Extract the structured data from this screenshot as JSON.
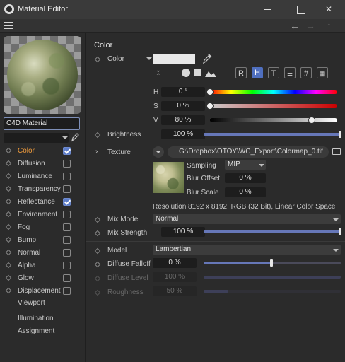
{
  "window": {
    "title": "Material Editor",
    "app_icon": "cinema4d-icon"
  },
  "toolbar": {
    "menu_icon": "hamburger-icon",
    "back_icon": "arrow-left-icon",
    "forward_icon": "arrow-right-icon",
    "up_icon": "arrow-up-icon"
  },
  "material": {
    "name": "C4D Material",
    "layer_value": ""
  },
  "channels": [
    {
      "label": "Color",
      "checked": true,
      "active": true
    },
    {
      "label": "Diffusion",
      "checked": false,
      "active": false
    },
    {
      "label": "Luminance",
      "checked": false,
      "active": false
    },
    {
      "label": "Transparency",
      "checked": false,
      "active": false
    },
    {
      "label": "Reflectance",
      "checked": true,
      "active": false
    },
    {
      "label": "Environment",
      "checked": false,
      "active": false
    },
    {
      "label": "Fog",
      "checked": false,
      "active": false
    },
    {
      "label": "Bump",
      "checked": false,
      "active": false
    },
    {
      "label": "Normal",
      "checked": false,
      "active": false
    },
    {
      "label": "Alpha",
      "checked": false,
      "active": false
    },
    {
      "label": "Glow",
      "checked": false,
      "active": false
    },
    {
      "label": "Displacement",
      "checked": false,
      "active": false
    }
  ],
  "extra_items": [
    "Viewport",
    "Illumination",
    "Assignment"
  ],
  "color_section": {
    "title": "Color",
    "color_label": "Color",
    "swatch_color": "#e8e8e8",
    "mode_letters": [
      "R",
      "H",
      "T",
      "#"
    ],
    "selected_mode": "H",
    "h_label": "H",
    "h_value": "0 °",
    "h_level": 0.0,
    "s_label": "S",
    "s_value": "0 %",
    "s_level": 0.0,
    "v_label": "V",
    "v_value": "80 %",
    "v_level": 0.8,
    "brightness_label": "Brightness",
    "brightness_value": "100 %",
    "brightness_level": 1.0,
    "texture_label": "Texture",
    "texture_path": "G:\\Dropbox\\OTOY\\WC_Export\\Colormap_0.tif",
    "sampling_label": "Sampling",
    "sampling_value": "MIP",
    "blur_offset_label": "Blur Offset",
    "blur_offset_value": "0 %",
    "blur_scale_label": "Blur Scale",
    "blur_scale_value": "0 %",
    "resolution_text": "Resolution 8192 x 8192, RGB (32 Bit), Linear Color Space",
    "mix_mode_label": "Mix Mode",
    "mix_mode_value": "Normal",
    "mix_strength_label": "Mix Strength",
    "mix_strength_value": "100 %",
    "mix_strength_level": 1.0,
    "model_label": "Model",
    "model_value": "Lambertian",
    "diffuse_falloff_label": "Diffuse Falloff",
    "diffuse_falloff_value": "0 %",
    "diffuse_falloff_level": 0.5,
    "diffuse_level_label": "Diffuse Level",
    "diffuse_level_value": "100 %",
    "diffuse_level_level": 1.0,
    "roughness_label": "Roughness",
    "roughness_value": "50 %",
    "roughness_level": 0.18
  },
  "colors": {
    "accent": "#4f6fbf",
    "active_channel": "#ee9a3c",
    "slider_fill": "#6677b8"
  }
}
